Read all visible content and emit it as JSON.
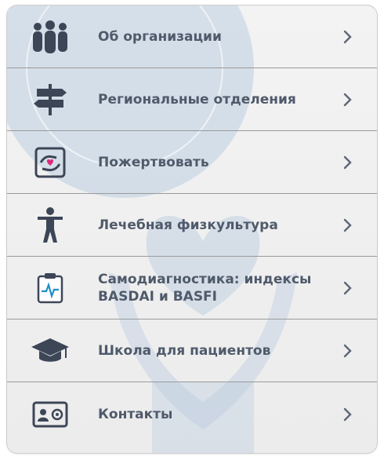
{
  "menu": {
    "items": [
      {
        "id": "about",
        "label": "Об организации",
        "icon": "people-icon"
      },
      {
        "id": "regional",
        "label": "Региональные отделения",
        "icon": "signpost-icon"
      },
      {
        "id": "donate",
        "label": "Пожертвовать",
        "icon": "donate-heart-icon"
      },
      {
        "id": "physio",
        "label": "Лечебная физкультура",
        "icon": "person-exercise-icon"
      },
      {
        "id": "selfdiag",
        "label": "Самодиагностика: индексы BASDAI и BASFI",
        "icon": "clipboard-pulse-icon"
      },
      {
        "id": "school",
        "label": "Школа для пациентов",
        "icon": "graduation-cap-icon"
      },
      {
        "id": "contacts",
        "label": "Контакты",
        "icon": "contact-card-icon"
      }
    ]
  },
  "colors": {
    "label": "#4f5a6b",
    "icon": "#3d4657",
    "chevron": "#5d6776",
    "divider": "#9a9a9a",
    "watermark": "#b9cadc",
    "donate_heart": "#e0287a"
  }
}
